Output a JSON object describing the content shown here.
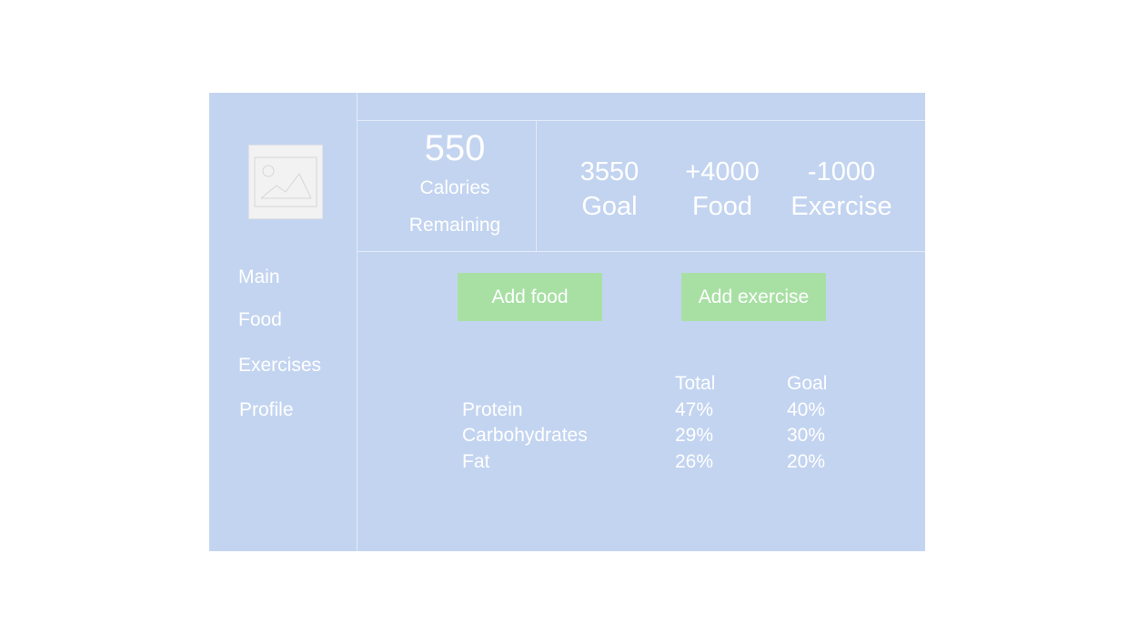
{
  "sidebar": {
    "avatar_icon": "image-placeholder-icon",
    "items": [
      {
        "label": "Main"
      },
      {
        "label": "Food"
      },
      {
        "label": "Exercises"
      },
      {
        "label": "Profile"
      }
    ]
  },
  "summary": {
    "remaining_value": "550",
    "remaining_label_line1": "Calories",
    "remaining_label_line2": "Remaining",
    "goal": {
      "value": "3550",
      "label": "Goal"
    },
    "food": {
      "value": "+4000",
      "label": "Food"
    },
    "exercise": {
      "value": "-1000",
      "label": "Exercise"
    }
  },
  "actions": {
    "add_food_label": "Add food",
    "add_exercise_label": "Add exercise"
  },
  "macros": {
    "headers": {
      "name": "",
      "total": "Total",
      "goal": "Goal"
    },
    "rows": [
      {
        "name": "Protein",
        "total": "47%",
        "goal": "40%"
      },
      {
        "name": "Carbohydrates",
        "total": "29%",
        "goal": "30%"
      },
      {
        "name": "Fat",
        "total": "26%",
        "goal": "20%"
      }
    ]
  },
  "colors": {
    "panel_background": "#c3d4f0",
    "button_background": "#a8e0a4",
    "text": "#ffffff",
    "divider": "#e3ebf8"
  }
}
